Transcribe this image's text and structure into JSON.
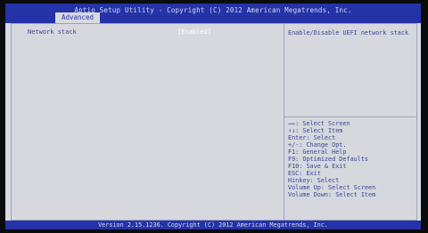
{
  "header": {
    "title": "Aptio Setup Utility - Copyright (C) 2012 American Megatrends, Inc.",
    "active_tab": "Advanced"
  },
  "settings": [
    {
      "label": "Network stack",
      "value": "[Enabled]"
    }
  ],
  "help": {
    "description": "Enable/Disable UEFI network stack",
    "keys": [
      "→←: Select Screen",
      "↑↓: Select Item",
      "Enter: Select",
      "+/-: Change Opt.",
      "F1: General Help",
      "F9: Optimized Defaults",
      "F10: Save & Exit",
      "ESC: Exit",
      "Hinkey: Select",
      "Volume Up: Select Screen",
      "Volume Down: Select Item"
    ]
  },
  "footer": {
    "version": "Version 2.15.1236. Copyright (C) 2012 American Megatrends, Inc."
  },
  "colors": {
    "bar_blue": "#2433a8",
    "panel_gray": "#d8dae0",
    "text_blue": "#3b4496",
    "highlight_white": "#ffffff"
  }
}
